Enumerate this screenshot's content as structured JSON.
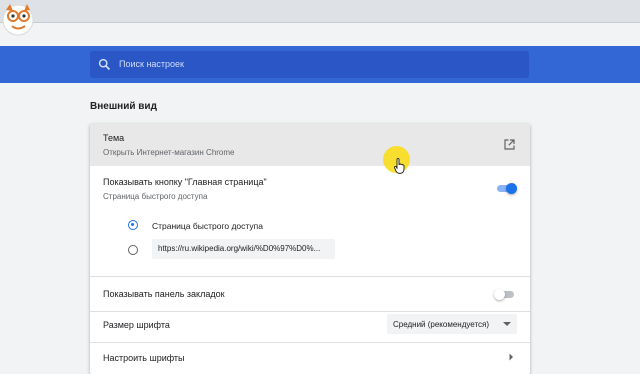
{
  "search": {
    "placeholder": "Поиск настроек",
    "icon": "search-icon"
  },
  "section": {
    "title": "Внешний вид"
  },
  "theme": {
    "title": "Тема",
    "subtitle": "Открыть Интернет-магазин Chrome",
    "icon": "open-in-new-icon"
  },
  "home_button": {
    "title": "Показывать кнопку \"Главная страница\"",
    "subtitle": "Страница быстрого доступа",
    "enabled": true,
    "options": [
      {
        "label": "Страница быстрого доступа",
        "selected": true
      },
      {
        "value": "https://ru.wikipedia.org/wiki/%D0%97%D0%...",
        "selected": false
      }
    ]
  },
  "bookmarks_bar": {
    "title": "Показывать панель закладок",
    "enabled": false
  },
  "font_size": {
    "title": "Размер шрифта",
    "value": "Средний (рекомендуется)"
  },
  "fonts": {
    "title": "Настроить шрифты"
  },
  "colors": {
    "header_blue": "#3367d6",
    "accent": "#1a73e8",
    "cursor_highlight": "#f7dc1e"
  }
}
